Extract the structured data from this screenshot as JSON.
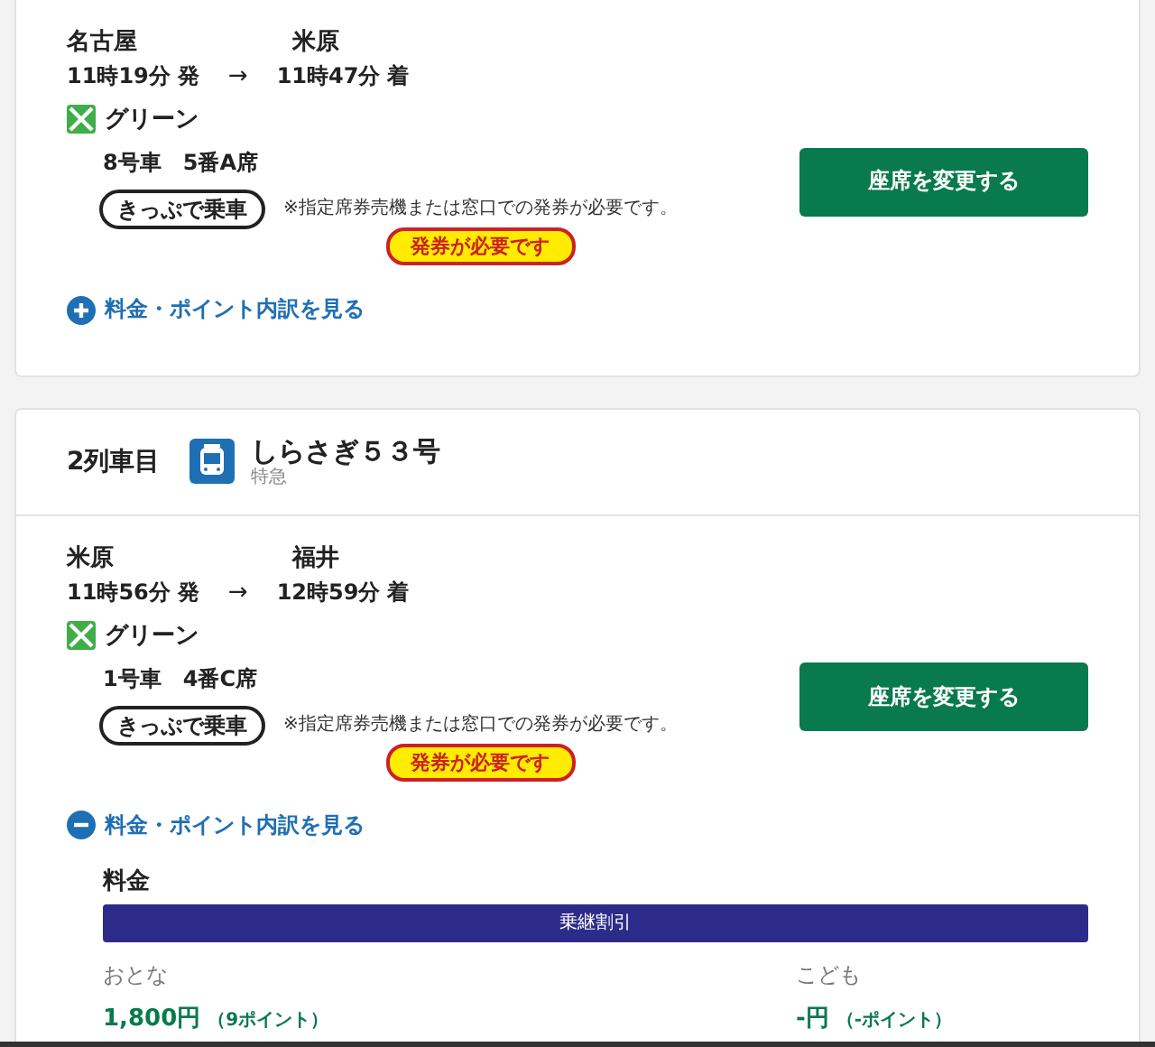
{
  "segments": [
    {
      "from": "名古屋",
      "to": "米原",
      "depart_time": "**11**時**19**分",
      "depart_label": "発",
      "arrow": "→",
      "arrive_time": "**11**時**47**分",
      "arrive_label": "着",
      "car_class": "グリーン",
      "seat": "**8**号車　**5**番**A**席",
      "ticket_type": "きっぷで乗車",
      "notice": "※指定席券売機または窓口での発券が必要です。",
      "badge": "発券が必要です",
      "change_button": "座席を変更する",
      "fare_link": {
        "label": "料金・ポイント内訳を見る",
        "expanded": false
      }
    },
    {
      "train": {
        "position": "2列車目",
        "name": "しらさぎ５３号",
        "type": "特急"
      },
      "from": "米原",
      "to": "福井",
      "depart_time": "**11**時**56**分",
      "depart_label": "発",
      "arrow": "→",
      "arrive_time": "**12**時**59**分",
      "arrive_label": "着",
      "car_class": "グリーン",
      "seat": "**1**号車　**4**番**C**席",
      "ticket_type": "きっぷで乗車",
      "notice": "※指定席券売機または窓口での発券が必要です。",
      "badge": "発券が必要です",
      "change_button": "座席を変更する",
      "fare_link": {
        "label": "料金・ポイント内訳を見る",
        "expanded": true
      },
      "fare": {
        "heading": "料金",
        "discount": "乗継割引",
        "adult": {
          "label": "おとな",
          "price": "1,800円",
          "points": "（9ポイント）"
        },
        "child": {
          "label": "こども",
          "price": "-円",
          "points": "（-ポイント）"
        }
      }
    }
  ]
}
